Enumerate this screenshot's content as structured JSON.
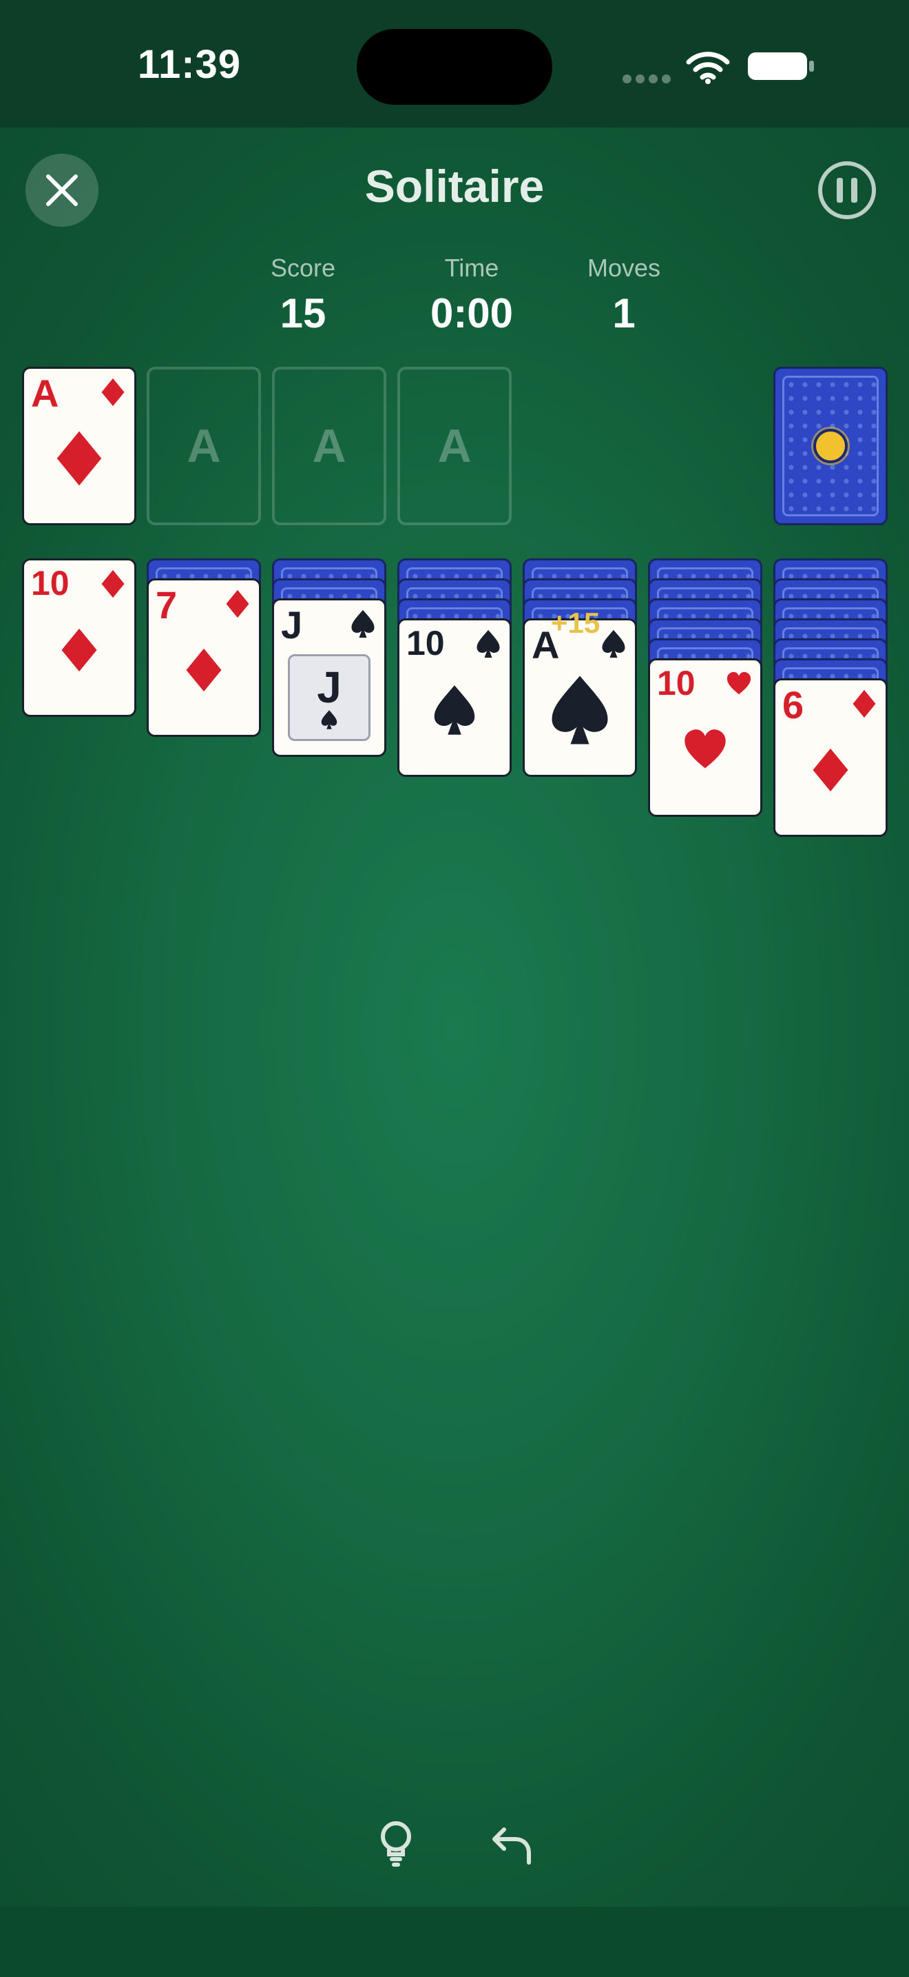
{
  "status_bar": {
    "time": "11:39",
    "wifi_icon": "wifi-icon",
    "battery_icon": "battery-icon"
  },
  "header": {
    "title": "Solitaire",
    "close_icon": "close-icon",
    "pause_icon": "pause-icon"
  },
  "stats": [
    {
      "label": "Score",
      "value": "15"
    },
    {
      "label": "Time",
      "value": "0:00"
    },
    {
      "label": "Moves",
      "value": "1"
    }
  ],
  "foundations": [
    {
      "type": "card",
      "rank": "A",
      "suit": "diamonds"
    },
    {
      "type": "empty",
      "label": "A"
    },
    {
      "type": "empty",
      "label": "A"
    },
    {
      "type": "empty",
      "label": "A"
    }
  ],
  "stock": {
    "face_down": true
  },
  "tableau": [
    {
      "face_down_count": 0,
      "top": {
        "rank": "10",
        "suit": "diamonds"
      }
    },
    {
      "face_down_count": 1,
      "top": {
        "rank": "7",
        "suit": "diamonds"
      }
    },
    {
      "face_down_count": 2,
      "top": {
        "rank": "J",
        "suit": "spades",
        "face_card": true
      }
    },
    {
      "face_down_count": 3,
      "top": {
        "rank": "10",
        "suit": "spades"
      }
    },
    {
      "face_down_count": 3,
      "top": {
        "rank": "A",
        "suit": "spades"
      }
    },
    {
      "face_down_count": 5,
      "top": {
        "rank": "10",
        "suit": "hearts"
      }
    },
    {
      "face_down_count": 6,
      "top": {
        "rank": "6",
        "suit": "diamonds"
      }
    }
  ],
  "score_popup": "+15",
  "toolbar": {
    "hint_icon": "lightbulb-icon",
    "undo_icon": "undo-icon"
  },
  "colors": {
    "red_suit": "#d71f2b",
    "black_suit": "#1a1f2c",
    "card_back": "#2e47c4",
    "felt": "#156841"
  }
}
